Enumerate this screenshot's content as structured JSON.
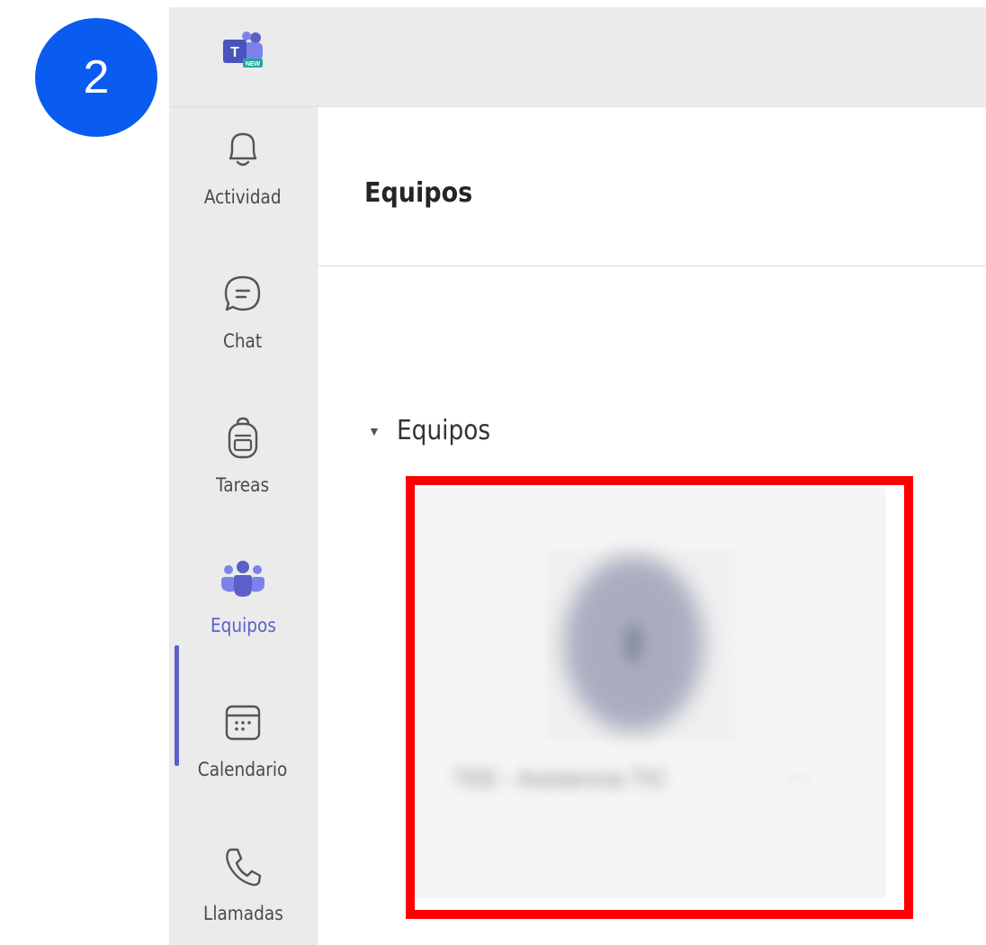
{
  "annotation": {
    "step_number": "2",
    "badge_color": "#0a5cf0",
    "highlight_color": "#ff0000"
  },
  "app": {
    "name": "Microsoft Teams",
    "logo_icon": "teams-logo-icon",
    "accent_color": "#5b5fc7"
  },
  "rail": {
    "items": [
      {
        "label": "Actividad",
        "icon": "bell-icon",
        "active": false
      },
      {
        "label": "Chat",
        "icon": "chat-icon",
        "active": false
      },
      {
        "label": "Tareas",
        "icon": "backpack-icon",
        "active": false
      },
      {
        "label": "Equipos",
        "icon": "teams-icon",
        "active": true
      },
      {
        "label": "Calendario",
        "icon": "calendar-icon",
        "active": false
      },
      {
        "label": "Llamadas",
        "icon": "phone-icon",
        "active": false
      }
    ]
  },
  "main": {
    "title": "Equipos",
    "section": {
      "label": "Equipos",
      "expanded": true,
      "caret_icon": "caret-down-icon"
    },
    "team_card": {
      "name": "TEE - Asistencia TIC",
      "more_label": "···",
      "blurred": true
    }
  }
}
